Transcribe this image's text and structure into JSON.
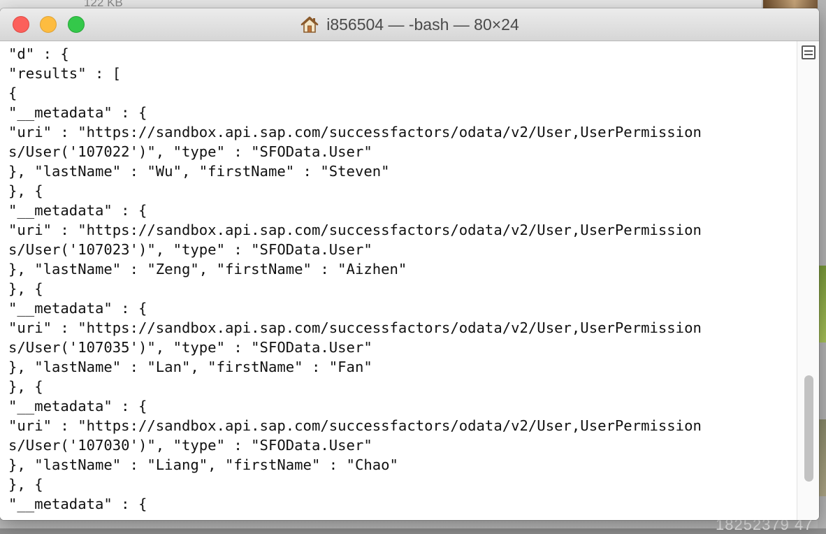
{
  "background": {
    "finder_size_text": "122 KB",
    "bottom_text": "18252379 47"
  },
  "window": {
    "title": "i856504 — -bash — 80×24",
    "title_icon": "home-icon",
    "controls": {
      "close": "close-button",
      "minimize": "minimize-button",
      "zoom": "zoom-button"
    }
  },
  "terminal": {
    "lines": [
      "\"d\" : {",
      "\"results\" : [",
      "{",
      "\"__metadata\" : {",
      "\"uri\" : \"https://sandbox.api.sap.com/successfactors/odata/v2/User,UserPermission",
      "s/User('107022')\", \"type\" : \"SFOData.User\"",
      "}, \"lastName\" : \"Wu\", \"firstName\" : \"Steven\"",
      "}, {",
      "\"__metadata\" : {",
      "\"uri\" : \"https://sandbox.api.sap.com/successfactors/odata/v2/User,UserPermission",
      "s/User('107023')\", \"type\" : \"SFOData.User\"",
      "}, \"lastName\" : \"Zeng\", \"firstName\" : \"Aizhen\"",
      "}, {",
      "\"__metadata\" : {",
      "\"uri\" : \"https://sandbox.api.sap.com/successfactors/odata/v2/User,UserPermission",
      "s/User('107035')\", \"type\" : \"SFOData.User\"",
      "}, \"lastName\" : \"Lan\", \"firstName\" : \"Fan\"",
      "}, {",
      "\"__metadata\" : {",
      "\"uri\" : \"https://sandbox.api.sap.com/successfactors/odata/v2/User,UserPermission",
      "s/User('107030')\", \"type\" : \"SFOData.User\"",
      "}, \"lastName\" : \"Liang\", \"firstName\" : \"Chao\"",
      "}, {",
      "\"__metadata\" : {"
    ]
  },
  "scrollbar": {
    "split_icon": "split-pane-icon"
  },
  "colors": {
    "close": "#fc605b",
    "minimize": "#fdbc40",
    "zoom": "#34c84a",
    "terminal_bg": "#ffffff",
    "terminal_text": "#111111"
  }
}
